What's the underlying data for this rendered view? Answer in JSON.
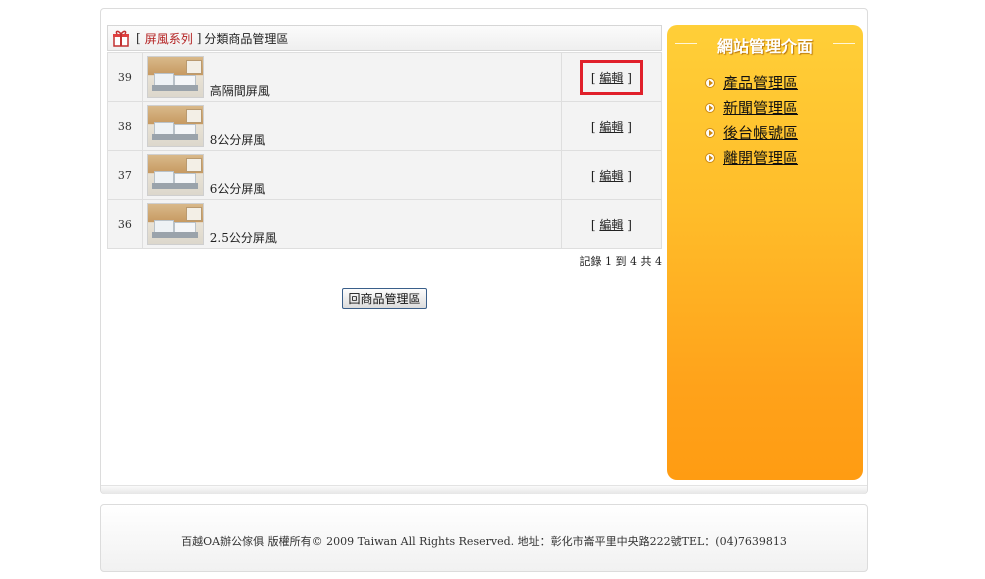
{
  "category_header": {
    "open_bracket": "[",
    "category_name": "屏風系列",
    "close_bracket": "]",
    "title": "分類商品管理區"
  },
  "products": [
    {
      "id": "39",
      "name": "高隔間屏風",
      "edit_label": "編輯"
    },
    {
      "id": "38",
      "name": "8公分屏風",
      "edit_label": "編輯"
    },
    {
      "id": "37",
      "name": "6公分屏風",
      "edit_label": "編輯"
    },
    {
      "id": "36",
      "name": "2.5公分屏風",
      "edit_label": "編輯"
    }
  ],
  "edit_bracket_open": "[",
  "edit_bracket_close": "]",
  "record_info": "記錄 1 到 4 共 4",
  "back_button_label": "回商品管理區",
  "sidebar": {
    "title": "網站管理介面",
    "items": [
      {
        "label": "產品管理區"
      },
      {
        "label": "新聞管理區"
      },
      {
        "label": "後台帳號區"
      },
      {
        "label": "離開管理區"
      }
    ]
  },
  "footer": {
    "text": "百越OA辦公傢俱 版權所有© 2009 Taiwan All Rights Reserved. 地址：彰化市崙平里中央路222號TEL：(04)7639813"
  },
  "colors": {
    "highlight_border": "#e0202a",
    "category_link": "#b32020",
    "sidebar_top": "#ffcf38",
    "sidebar_bottom": "#ff9c12"
  },
  "icons": {
    "header_icon": "gift-icon",
    "menu_bullet": "arrow-circle-icon"
  }
}
